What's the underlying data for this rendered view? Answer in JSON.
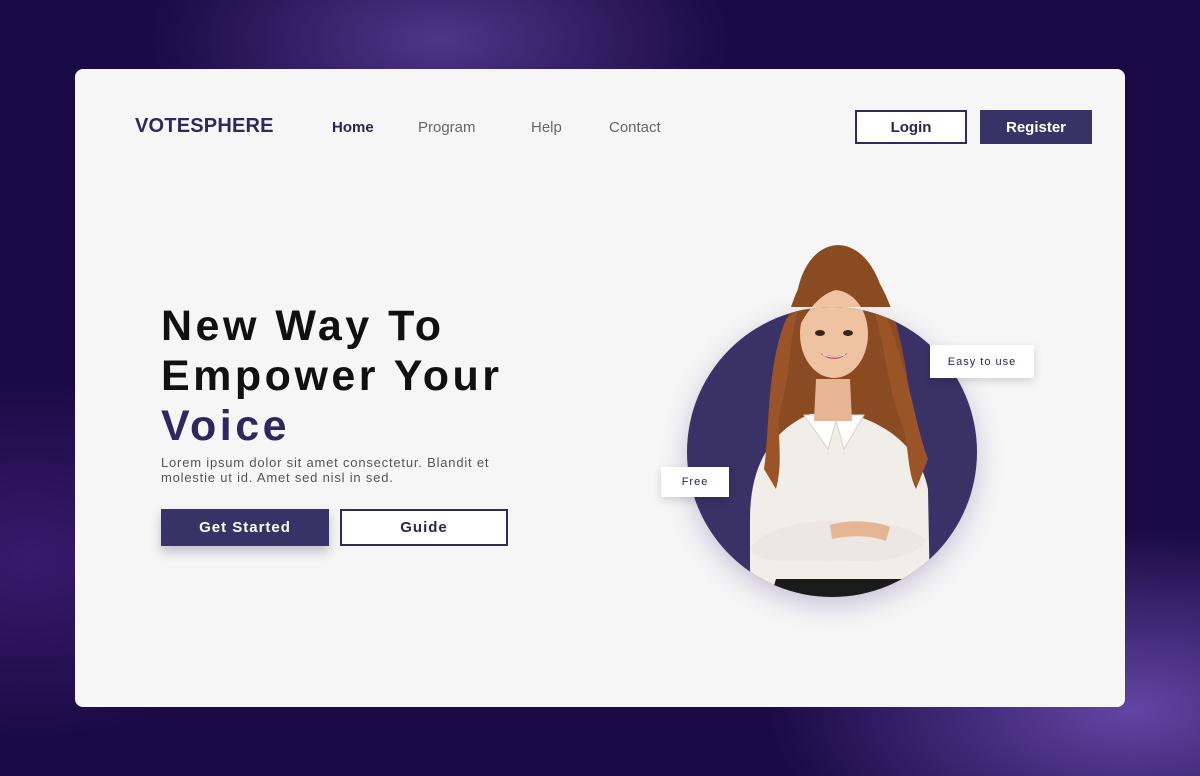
{
  "brand": {
    "name": "VOTESPHERE"
  },
  "nav": {
    "items": [
      {
        "label": "Home",
        "active": true
      },
      {
        "label": "Program",
        "active": false
      },
      {
        "label": "Help",
        "active": false
      },
      {
        "label": "Contact",
        "active": false
      }
    ]
  },
  "auth": {
    "login_label": "Login",
    "register_label": "Register"
  },
  "hero": {
    "title_line1": "New Way To",
    "title_line2": "Empower Your",
    "title_accent": "Voice",
    "description": "Lorem ipsum dolor sit amet consectetur. Blandit et molestie ut id. Amet sed nisl in sed.",
    "cta_primary": "Get Started",
    "cta_secondary": "Guide"
  },
  "badges": {
    "easy": "Easy to use",
    "free": "Free"
  },
  "colors": {
    "brand": "#2e2760",
    "primary_button": "#383266",
    "circle": "#3a3166",
    "card_bg": "#f6f6f6",
    "page_bg": "#1a0a45"
  },
  "icons": {
    "hero_image": "woman-portrait-image"
  }
}
